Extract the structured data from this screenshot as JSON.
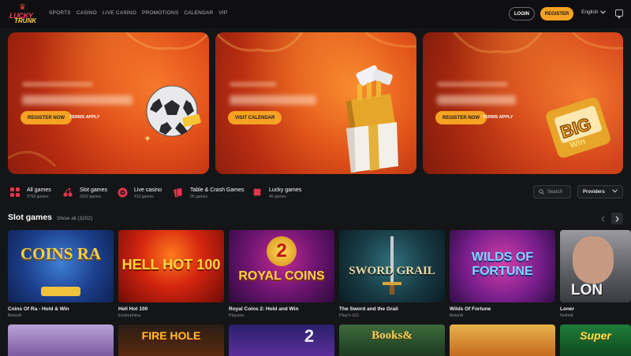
{
  "header": {
    "logo_line1": "LUCKY",
    "logo_line2": "TRUNK",
    "nav": [
      "SPORTS",
      "CASINO",
      "LIVE CASINO",
      "PROMOTIONS",
      "CALENDAR",
      "VIP"
    ],
    "login_label": "LOGIN",
    "register_label": "REGISTER",
    "language": "English"
  },
  "banners": [
    {
      "button_label": "REGISTER NOW",
      "terms_label": "TERMS APPLY"
    },
    {
      "button_label": "VISIT CALENDAR"
    },
    {
      "button_label": "REGISTER NOW",
      "terms_label": "TERMS APPLY"
    }
  ],
  "categories": [
    {
      "title": "All games",
      "count": "3758 games",
      "icon": "grid-icon"
    },
    {
      "title": "Slot games",
      "count": "3202 games",
      "icon": "cherry-icon"
    },
    {
      "title": "Live casino",
      "count": "413 games",
      "icon": "roulette-icon"
    },
    {
      "title": "Table & Crash Games",
      "count": "95 games",
      "icon": "cards-icon"
    },
    {
      "title": "Lucky games",
      "count": "46 games",
      "icon": "clover-icon"
    }
  ],
  "search": {
    "placeholder": "Search"
  },
  "providers": {
    "label": "Providers"
  },
  "section": {
    "title": "Slot games",
    "show_all": "Show all (3202)"
  },
  "games": [
    {
      "name": "Coins Of Ra - Hold & Win",
      "provider": "Betsoft",
      "art_text": "COINS RA"
    },
    {
      "name": "Hell Hot 100",
      "provider": "Endorphina",
      "art_text": "HELL HOT 100"
    },
    {
      "name": "Royal Coins 2: Hold and Win",
      "provider": "Playson",
      "art_text": "ROYAL COINS"
    },
    {
      "name": "The Sword and the Grail",
      "provider": "Play'n GO",
      "art_text": "SWORD GRAIL"
    },
    {
      "name": "Wilds Of Fortune",
      "provider": "Betsoft",
      "art_text": "WILDS OF FORTUNE"
    },
    {
      "name": "Loner",
      "provider": "Nolimit",
      "art_text": "LON"
    }
  ],
  "games_row2": [
    "",
    "FIRE HOLE",
    "",
    "2",
    "Books&",
    "",
    "Super"
  ],
  "colors": {
    "accent": "#f6a223",
    "brand_red": "#e8334f",
    "background": "#141517"
  }
}
